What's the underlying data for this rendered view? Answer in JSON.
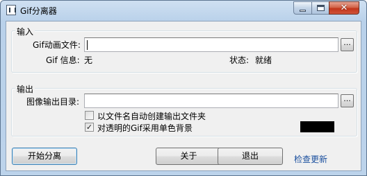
{
  "window": {
    "title": "Gif分离器",
    "controls": {
      "minimize": "minimize",
      "maximize": "maximize",
      "close": "✕"
    }
  },
  "input_group": {
    "legend": "输入",
    "file_label": "Gif动画文件:",
    "file_value": "",
    "browse_label": "...",
    "info_label": "Gif 信息:",
    "info_value": "无",
    "status_label": "状态:",
    "status_value": "就绪"
  },
  "output_group": {
    "legend": "输出",
    "dir_label": "图像输出目录:",
    "dir_value": "",
    "browse_label": "...",
    "option_subfolder": {
      "label": "以文件名自动创建输出文件夹",
      "checked": false
    },
    "option_transparent": {
      "label": "对透明的Gif采用单色背景",
      "checked": true,
      "mark": "✓"
    },
    "background_color": "#000000"
  },
  "buttons": {
    "start": "开始分离",
    "about": "关于",
    "exit": "退出",
    "check_update": "检查更新"
  },
  "colors": {
    "titlebar": "#bcd3eb",
    "close_button": "#c7432a",
    "dialog_bg": "#f0f0f0",
    "link": "#1a4f9e"
  }
}
